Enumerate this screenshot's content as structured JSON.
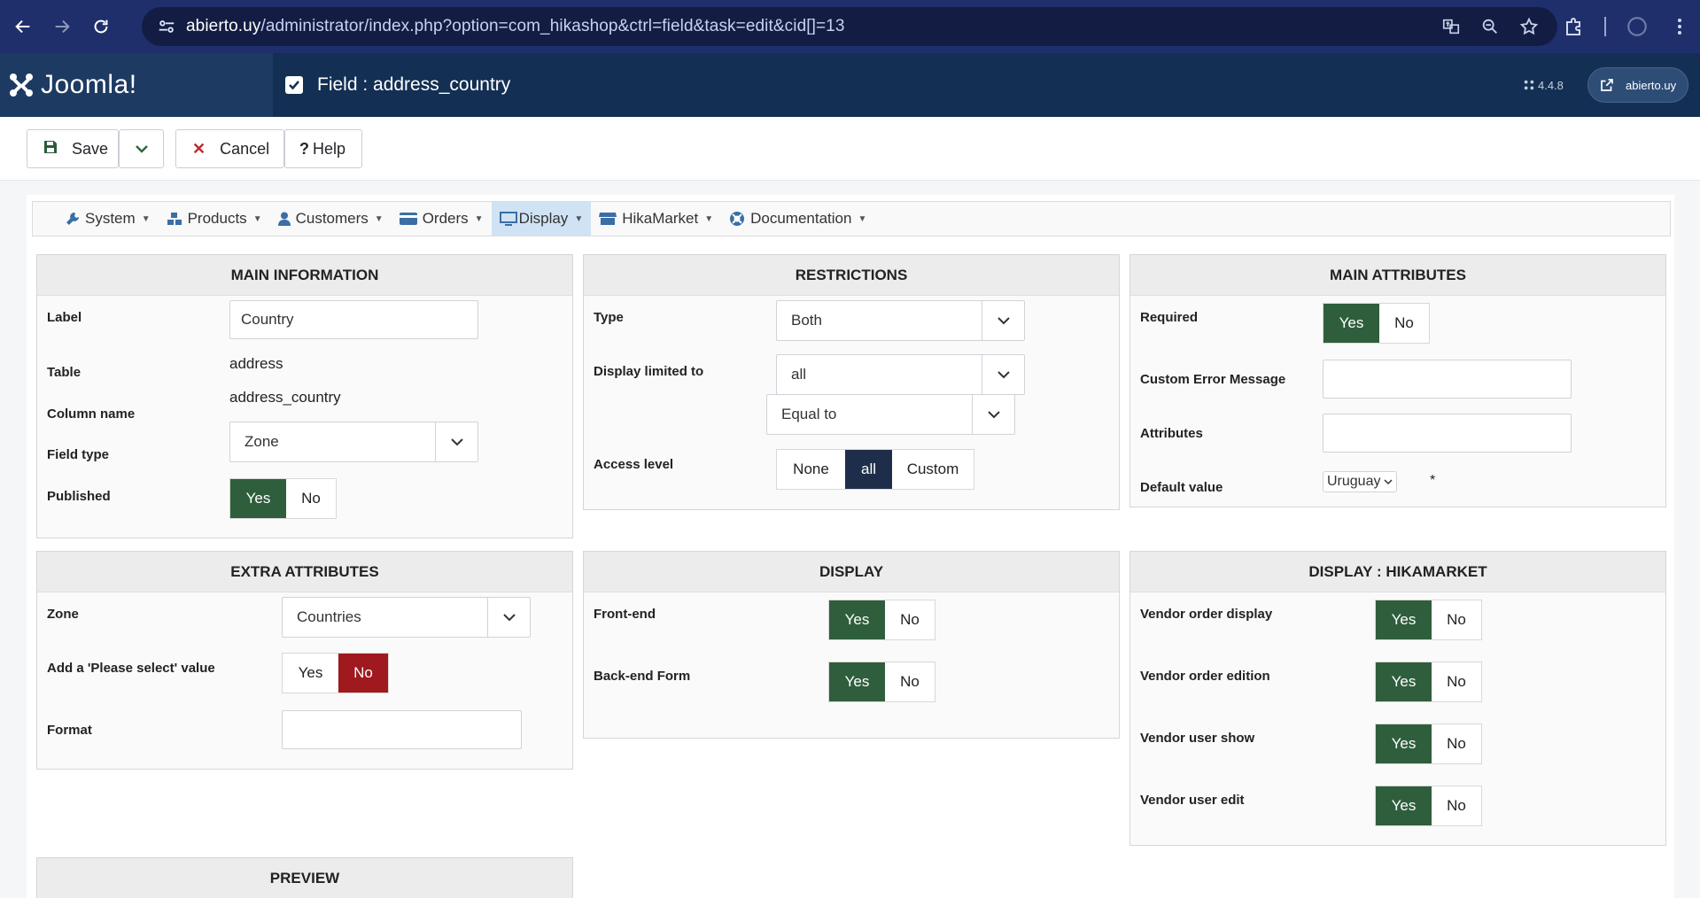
{
  "browser": {
    "url_host": "abierto.uy",
    "url_path": "/administrator/index.php?option=com_hikashop&ctrl=field&task=edit&cid[]=13"
  },
  "header": {
    "logo_text": "Joomla!",
    "title": "Field : address_country",
    "version": "4.4.8",
    "user": "abierto.uy"
  },
  "toolbar": {
    "save_label": "Save",
    "cancel_label": "Cancel",
    "help_label": "Help"
  },
  "menu": {
    "items": [
      {
        "label": "System",
        "icon": "wrench-icon"
      },
      {
        "label": "Products",
        "icon": "cubes-icon"
      },
      {
        "label": "Customers",
        "icon": "user-icon"
      },
      {
        "label": "Orders",
        "icon": "card-icon"
      },
      {
        "label": "Display",
        "icon": "monitor-icon"
      },
      {
        "label": "HikaMarket",
        "icon": "store-icon"
      },
      {
        "label": "Documentation",
        "icon": "lifebuoy-icon"
      }
    ]
  },
  "main_info": {
    "heading": "MAIN INFORMATION",
    "label_label": "Label",
    "label_value": "Country",
    "table_label": "Table",
    "table_value": "address",
    "column_label": "Column name",
    "column_value": "address_country",
    "fieldtype_label": "Field type",
    "fieldtype_value": "Zone",
    "published_label": "Published",
    "yes": "Yes",
    "no": "No"
  },
  "restrictions": {
    "heading": "RESTRICTIONS",
    "type_label": "Type",
    "type_value": "Both",
    "display_label": "Display limited to",
    "display_value": "all",
    "equal_value": "Equal to",
    "access_label": "Access level",
    "access_none": "None",
    "access_all": "all",
    "access_custom": "Custom"
  },
  "main_attributes": {
    "heading": "MAIN ATTRIBUTES",
    "required_label": "Required",
    "error_label": "Custom Error Message",
    "attributes_label": "Attributes",
    "default_label": "Default value",
    "default_value": "Uruguay",
    "asterisk": "*",
    "yes": "Yes",
    "no": "No"
  },
  "extra_attributes": {
    "heading": "EXTRA ATTRIBUTES",
    "zone_label": "Zone",
    "zone_value": "Countries",
    "please_select_label": "Add a 'Please select' value",
    "format_label": "Format",
    "yes": "Yes",
    "no": "No"
  },
  "display": {
    "heading": "DISPLAY",
    "frontend_label": "Front-end",
    "backend_label": "Back-end Form",
    "yes": "Yes",
    "no": "No"
  },
  "display_hikamarket": {
    "heading": "DISPLAY : HIKAMARKET",
    "order_display_label": "Vendor order display",
    "order_edition_label": "Vendor order edition",
    "user_show_label": "Vendor user show",
    "user_edit_label": "Vendor user edit",
    "yes": "Yes",
    "no": "No"
  },
  "preview": {
    "heading": "PREVIEW"
  }
}
